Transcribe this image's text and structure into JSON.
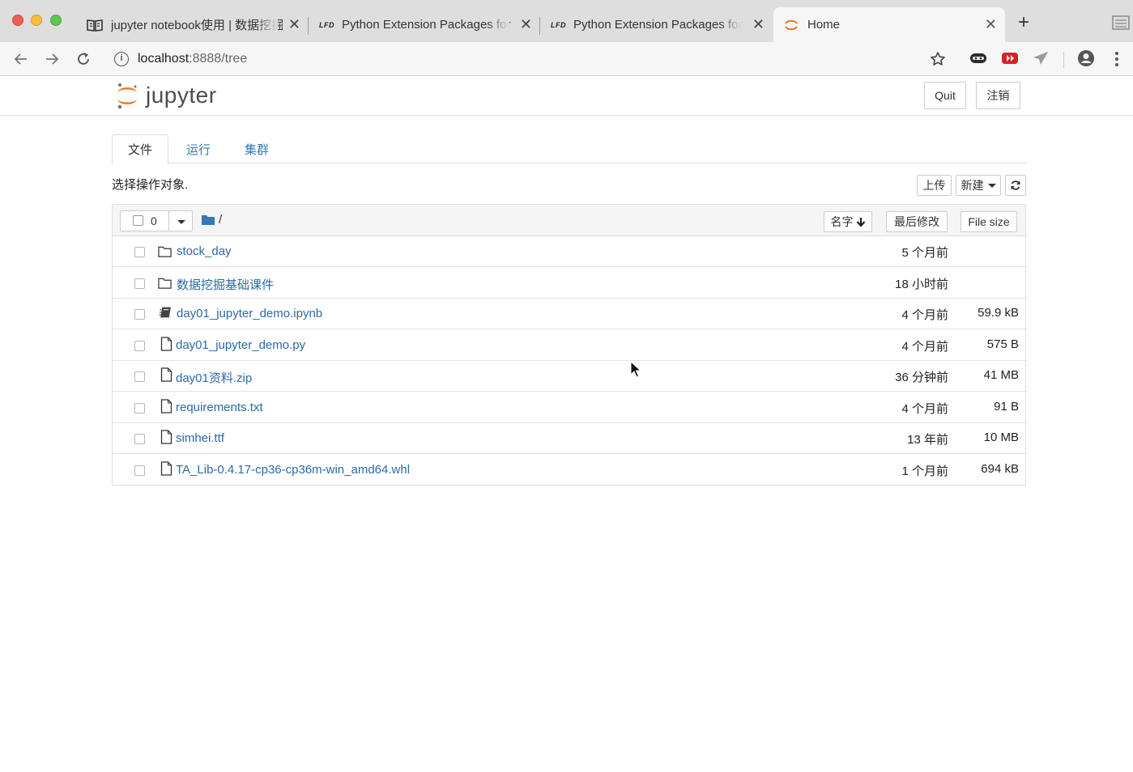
{
  "browser": {
    "tabs": [
      {
        "title": "jupyter notebook使用 | 数据挖掘",
        "active": false
      },
      {
        "title": "Python Extension Packages for",
        "active": false,
        "badge": "LFD"
      },
      {
        "title": "Python Extension Packages for",
        "active": false,
        "badge": "LFD"
      },
      {
        "title": "Home",
        "active": true
      }
    ],
    "new_tab": "+",
    "close_glyph": "✕",
    "url_host": "localhost",
    "url_path": ":8888/tree"
  },
  "header": {
    "logo_text": "jupyter",
    "quit_label": "Quit",
    "logout_label": "注销"
  },
  "nav_tabs": [
    {
      "label": "文件",
      "active": true
    },
    {
      "label": "运行",
      "active": false
    },
    {
      "label": "集群",
      "active": false
    }
  ],
  "toolbar": {
    "notice": "选择操作对象.",
    "upload_label": "上传",
    "new_label": "新建",
    "refresh_icon": "refresh-icon"
  },
  "list_header": {
    "selected_count": "0",
    "breadcrumb": "/",
    "sort_name": "名字",
    "sort_modified": "最后修改",
    "sort_size": "File size"
  },
  "files": [
    {
      "name": "stock_day",
      "type": "folder",
      "modified": "5 个月前",
      "size": ""
    },
    {
      "name": "数据挖掘基础课件",
      "type": "folder",
      "modified": "18 小时前",
      "size": ""
    },
    {
      "name": "day01_jupyter_demo.ipynb",
      "type": "notebook",
      "modified": "4 个月前",
      "size": "59.9 kB"
    },
    {
      "name": "day01_jupyter_demo.py",
      "type": "file",
      "modified": "4 个月前",
      "size": "575 B"
    },
    {
      "name": "day01资料.zip",
      "type": "file",
      "modified": "36 分钟前",
      "size": "41 MB"
    },
    {
      "name": "requirements.txt",
      "type": "file",
      "modified": "4 个月前",
      "size": "91 B"
    },
    {
      "name": "simhei.ttf",
      "type": "file",
      "modified": "13 年前",
      "size": "10 MB"
    },
    {
      "name": "TA_Lib-0.4.17-cp36-cp36m-win_amd64.whl",
      "type": "file",
      "modified": "1 个月前",
      "size": "694 kB"
    }
  ],
  "colors": {
    "link": "#2c6aa8",
    "jupyter_orange": "#f37726",
    "folder_blue": "#337ab7"
  }
}
